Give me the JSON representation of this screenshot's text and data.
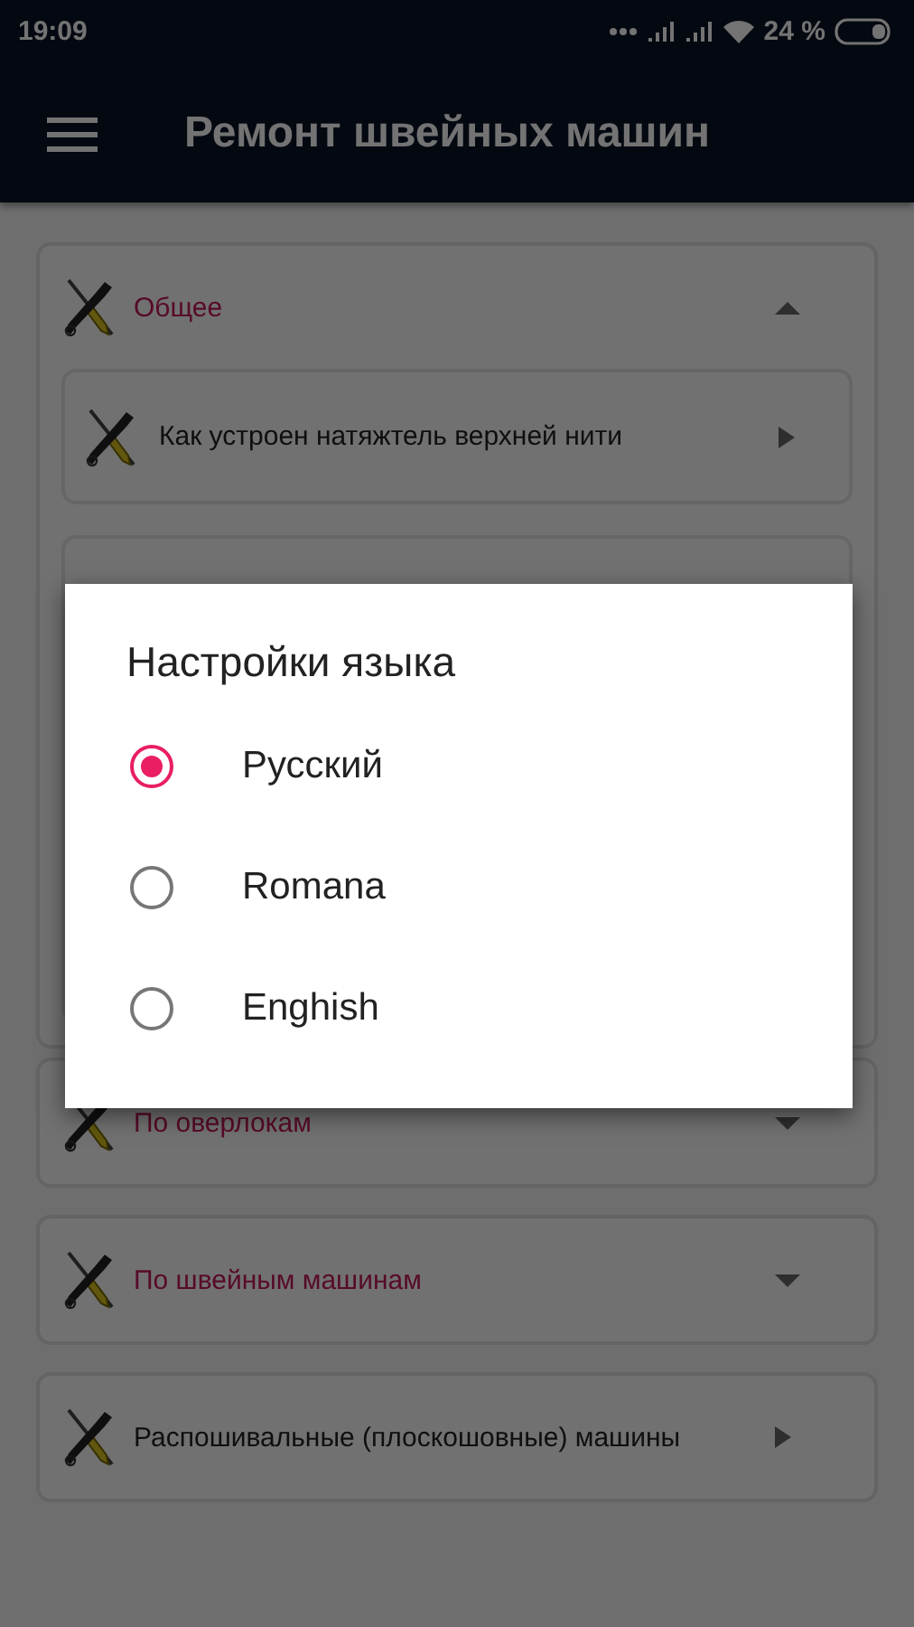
{
  "status_bar": {
    "time": "19:09",
    "battery_text": "24 %"
  },
  "app_bar": {
    "title": "Ремонт швейных машин"
  },
  "sections": [
    {
      "kind": "group",
      "title": "Общее",
      "expanded": true,
      "children": [
        {
          "kind": "item",
          "title": "Как устроен натяжтель верхней нити"
        },
        {
          "kind": "covered"
        }
      ]
    },
    {
      "kind": "group",
      "title": "По оверлокам",
      "expanded": false
    },
    {
      "kind": "group",
      "title": "По швейным машинам",
      "expanded": false
    },
    {
      "kind": "item",
      "title": "Распошивальные (плоскошовные) машины"
    }
  ],
  "dialog": {
    "title": "Настройки языка",
    "options": [
      {
        "label": "Русский",
        "selected": true
      },
      {
        "label": "Romana",
        "selected": false
      },
      {
        "label": "Enghish",
        "selected": false
      }
    ]
  }
}
